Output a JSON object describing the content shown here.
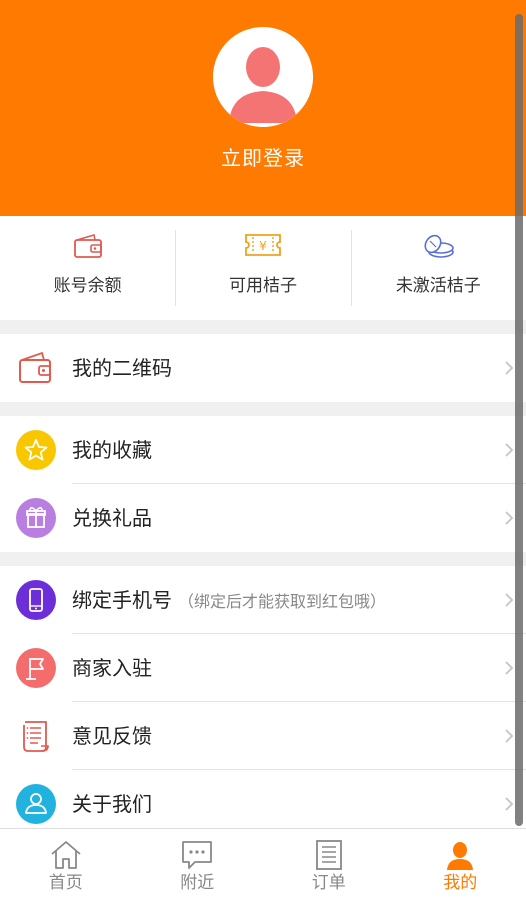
{
  "header": {
    "login_label": "立即登录"
  },
  "stats": [
    {
      "label": "账号余额",
      "icon": "wallet-icon"
    },
    {
      "label": "可用桔子",
      "icon": "ticket-icon"
    },
    {
      "label": "未激活桔子",
      "icon": "coins-icon"
    }
  ],
  "menu": {
    "qrcode": {
      "label": "我的二维码",
      "icon": "wallet-icon"
    },
    "favorites": {
      "label": "我的收藏",
      "icon": "star-icon"
    },
    "gifts": {
      "label": "兑换礼品",
      "icon": "gift-icon"
    },
    "bind_phone": {
      "label": "绑定手机号",
      "hint": "（绑定后才能获取到红包哦）",
      "icon": "phone-icon"
    },
    "merchant": {
      "label": "商家入驻",
      "icon": "flag-icon"
    },
    "feedback": {
      "label": "意见反馈",
      "icon": "scroll-icon"
    },
    "about": {
      "label": "关于我们",
      "icon": "user-icon"
    }
  },
  "tabbar": [
    {
      "label": "首页",
      "icon": "home-icon"
    },
    {
      "label": "附近",
      "icon": "chat-icon"
    },
    {
      "label": "订单",
      "icon": "document-icon"
    },
    {
      "label": "我的",
      "icon": "user-icon",
      "active": true
    }
  ],
  "colors": {
    "accent": "#ff7a00",
    "star": "#f8c700",
    "gift": "#b87fe0",
    "phone": "#6c2ed8",
    "merchant": "#f36d6d",
    "about": "#22b2e0"
  }
}
